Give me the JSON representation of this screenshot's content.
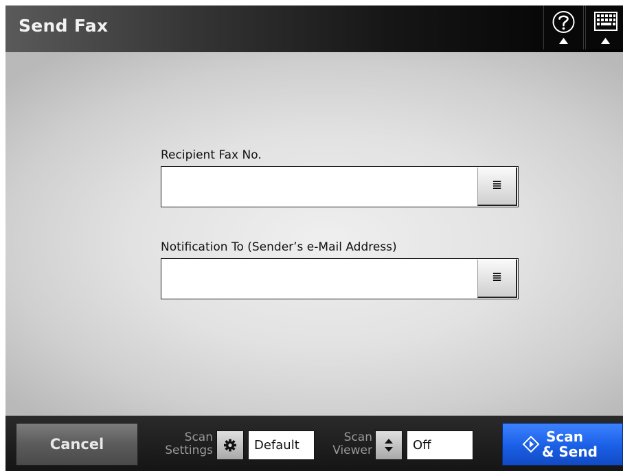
{
  "header": {
    "title": "Send Fax",
    "help_icon": "help-question-icon",
    "keyboard_icon": "keyboard-icon"
  },
  "form": {
    "recipient_label": "Recipient Fax No.",
    "recipient_value": "",
    "recipient_list_icon": "list-icon",
    "notification_label": "Notification To (Sender’s e-Mail Address)",
    "notification_value": "",
    "notification_list_icon": "list-icon",
    "list_glyph": "≣"
  },
  "footer": {
    "cancel_label": "Cancel",
    "scan_settings_line1": "Scan",
    "scan_settings_line2": "Settings",
    "scan_settings_icon": "gear-icon",
    "scan_settings_value": "Default",
    "scan_viewer_line1": "Scan",
    "scan_viewer_line2": "Viewer",
    "scan_viewer_icon": "up-down-arrows-icon",
    "scan_viewer_value": "Off",
    "scan_send_line1": "Scan",
    "scan_send_line2": "& Send",
    "scan_send_icon": "diamond-start-icon"
  },
  "colors": {
    "accent": "#1a5fe6",
    "title_bar": "#000000",
    "background": "#e2e2e2"
  }
}
